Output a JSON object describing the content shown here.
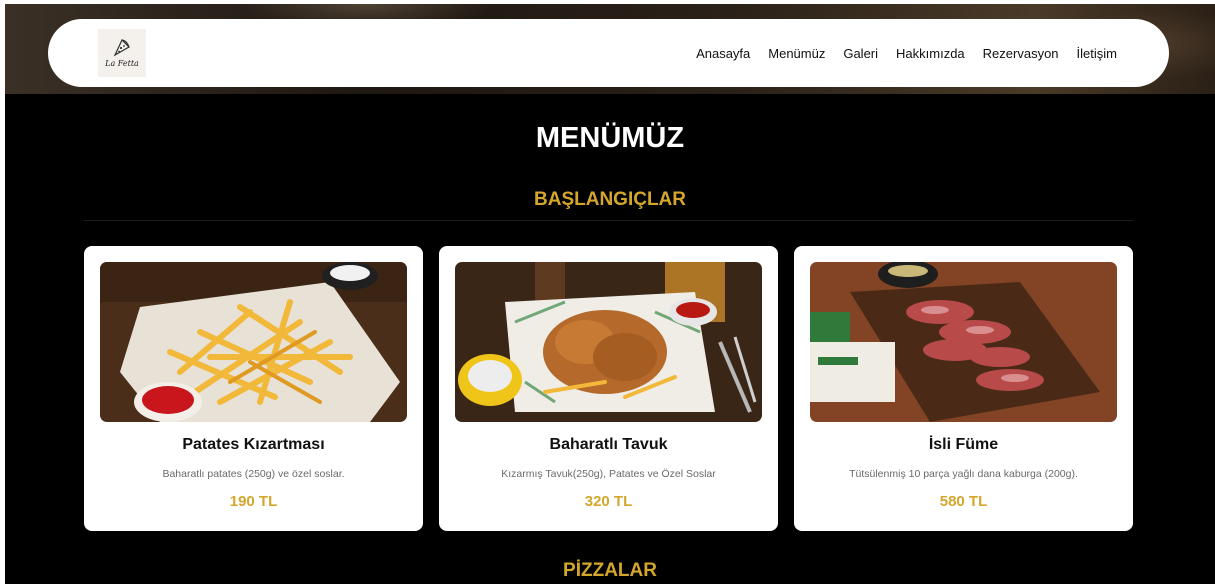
{
  "navbar": {
    "logo_text": "La Fetta",
    "links": [
      "Anasayfa",
      "Menümüz",
      "Galeri",
      "Hakkımızda",
      "Rezervasyon",
      "İletişim"
    ]
  },
  "menu": {
    "title": "MENÜMÜZ",
    "categories": [
      {
        "name": "BAŞLANGIÇLAR",
        "items": [
          {
            "name": "Patates Kızartması",
            "description": "Baharatlı patates (250g) ve özel soslar.",
            "price": "190 TL"
          },
          {
            "name": "Baharatlı Tavuk",
            "description": "Kızarmış Tavuk(250g), Patates ve Özel Soslar",
            "price": "320 TL"
          },
          {
            "name": "İsli Füme",
            "description": "Tütsülenmiş 10 parça yağlı dana kaburga (200g).",
            "price": "580 TL"
          }
        ]
      },
      {
        "name": "PİZZALAR"
      }
    ]
  },
  "colors": {
    "accent_gold": "#d4a72c",
    "background": "#000000",
    "card": "#ffffff"
  }
}
